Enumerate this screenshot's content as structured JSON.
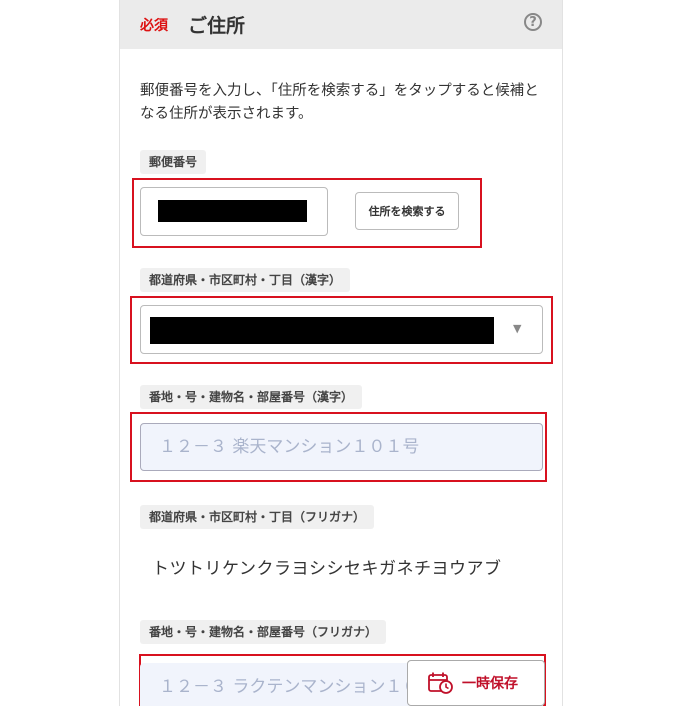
{
  "header": {
    "required_badge": "必須",
    "title": "ご住所",
    "help_glyph": "?"
  },
  "description": "郵便番号を入力し、「住所を検索する」をタップすると候補となる住所が表示されます。",
  "postal": {
    "label": "郵便番号",
    "search_button": "住所を検索する"
  },
  "prefecture": {
    "label": "都道府県・市区町村・丁目（漢字）",
    "dropdown_arrow": "▼"
  },
  "street": {
    "label": "番地・号・建物名・部屋番号（漢字）",
    "placeholder": "１２－３ 楽天マンション１０１号"
  },
  "prefecture_kana": {
    "label": "都道府県・市区町村・丁目（フリガナ）",
    "value": "トツトリケンクラヨシシセキガネチヨウアブ"
  },
  "street_kana": {
    "label": "番地・号・建物名・部屋番号（フリガナ）",
    "placeholder": "１２－３ ラクテンマンション１０１ゴウ"
  },
  "save": {
    "label": "一時保存",
    "icon": "calendar-clock-icon"
  },
  "colors": {
    "accent_red": "#d8111f",
    "header_bg": "#ebebeb"
  }
}
